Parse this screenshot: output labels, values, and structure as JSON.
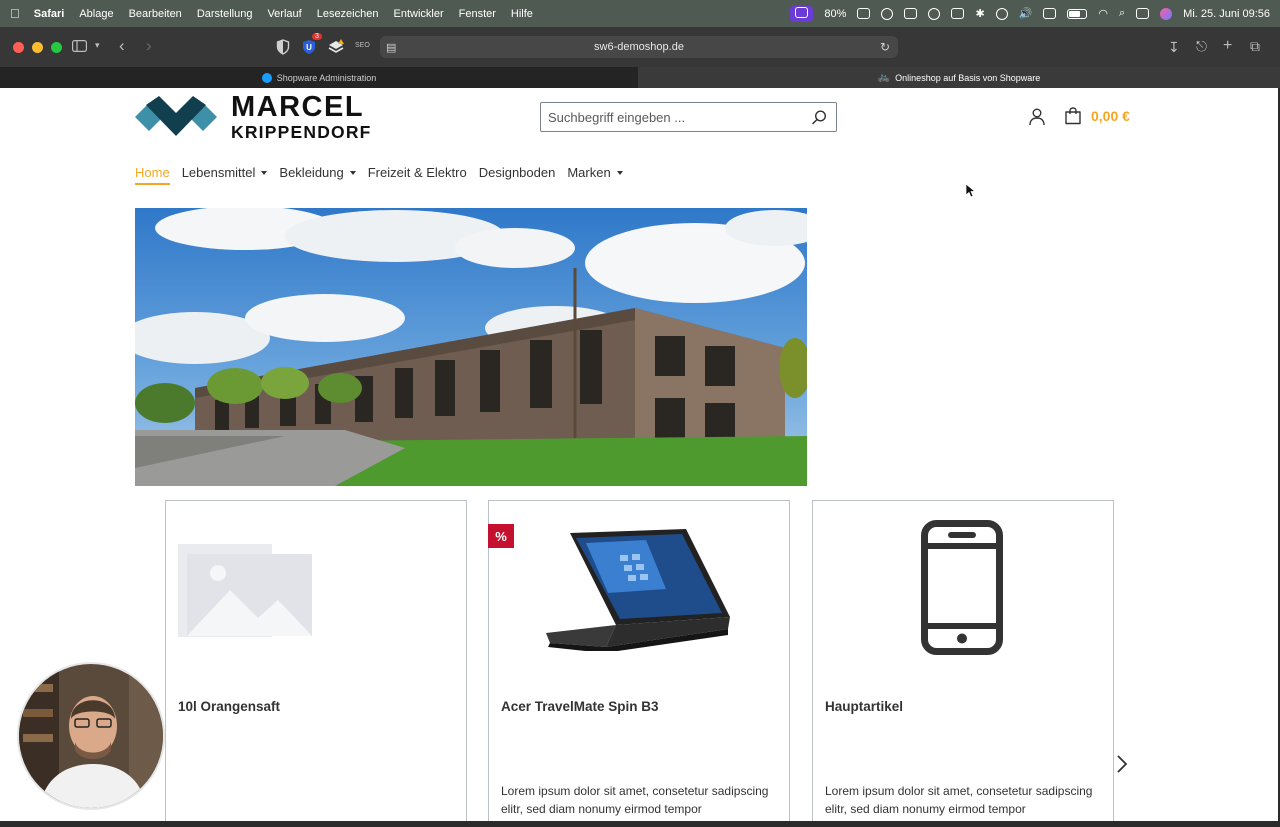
{
  "menubar": {
    "app": "Safari",
    "menus": [
      "Ablage",
      "Bearbeiten",
      "Darstellung",
      "Verlauf",
      "Lesezeichen",
      "Entwickler",
      "Fenster",
      "Hilfe"
    ],
    "cpu": "80%",
    "datetime": "Mi. 25. Juni  09:56"
  },
  "toolbar": {
    "url": "sw6-demoshop.de",
    "seo_label": "SEO",
    "extension_badge": "3"
  },
  "tabs": [
    {
      "label": "Shopware Administration",
      "active": false
    },
    {
      "label": "Onlineshop auf Basis von Shopware",
      "active": true
    }
  ],
  "shop": {
    "logo_line1": "MARCEL",
    "logo_line2": "KRIPPENDORF",
    "search_placeholder": "Suchbegriff eingeben ...",
    "cart_amount": "0,00 €",
    "accent": "#f5a623",
    "nav": [
      {
        "label": "Home",
        "active": true,
        "dropdown": false
      },
      {
        "label": "Lebensmittel",
        "active": false,
        "dropdown": true
      },
      {
        "label": "Bekleidung",
        "active": false,
        "dropdown": true
      },
      {
        "label": "Freizeit & Elektro",
        "active": false,
        "dropdown": false
      },
      {
        "label": "Designboden",
        "active": false,
        "dropdown": false
      },
      {
        "label": "Marken",
        "active": false,
        "dropdown": true
      }
    ],
    "products": [
      {
        "title": "10l Orangensaft",
        "description": "",
        "image": "placeholder-image-icon",
        "badge": ""
      },
      {
        "title": "Acer TravelMate Spin B3",
        "description": "Lorem ipsum dolor sit amet, consetetur sadipscing elitr, sed diam nonumy eirmod tempor",
        "image": "laptop-image",
        "badge": "%"
      },
      {
        "title": "Hauptartikel",
        "description": "Lorem ipsum dolor sit amet, consetetur sadipscing elitr, sed diam nonumy eirmod tempor",
        "image": "smartphone-icon",
        "badge": ""
      }
    ]
  }
}
